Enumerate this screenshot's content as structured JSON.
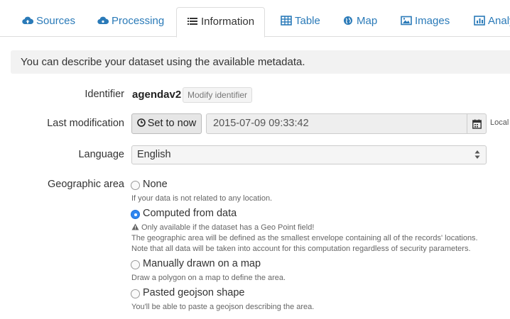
{
  "tabs": [
    {
      "label": "Sources",
      "icon": "cloud-upload-icon"
    },
    {
      "label": "Processing",
      "icon": "cloud-cog-icon"
    },
    {
      "label": "Information",
      "icon": "list-icon"
    },
    {
      "label": "Table",
      "icon": "table-icon"
    },
    {
      "label": "Map",
      "icon": "globe-icon"
    },
    {
      "label": "Images",
      "icon": "image-icon"
    },
    {
      "label": "Analy",
      "icon": "bar-chart-icon"
    }
  ],
  "active_tab": "Information",
  "notice": "You can describe your dataset using the available metadata.",
  "identifier": {
    "label": "Identifier",
    "value": "agendav2",
    "modify_label": "Modify identifier"
  },
  "last_modification": {
    "label": "Last modification",
    "set_now_label": "Set to now",
    "value": "2015-07-09 09:33:42",
    "suffix": "Local"
  },
  "language": {
    "label": "Language",
    "selected": "English"
  },
  "geographic_area": {
    "label": "Geographic area",
    "options": [
      {
        "label": "None",
        "checked": false,
        "help": [
          "If your data is not related to any location."
        ]
      },
      {
        "label": "Computed from data",
        "checked": true,
        "warning": "Only available if the dataset has a Geo Point field!",
        "help": [
          "The geographic area will be defined as the smallest envelope containing all of the records' locations.",
          "Note that all data will be taken into account for this computation regardless of security parameters."
        ]
      },
      {
        "label": "Manually drawn on a map",
        "checked": false,
        "help": [
          "Draw a polygon on a map to define the area."
        ]
      },
      {
        "label": "Pasted geojson shape",
        "checked": false,
        "help": [
          "You'll be able to paste a geojson describing the area."
        ]
      }
    ]
  },
  "colors": {
    "link": "#2a7ab8",
    "radio_checked": "#2f86f0",
    "notice_bg": "#f2f2f2"
  }
}
